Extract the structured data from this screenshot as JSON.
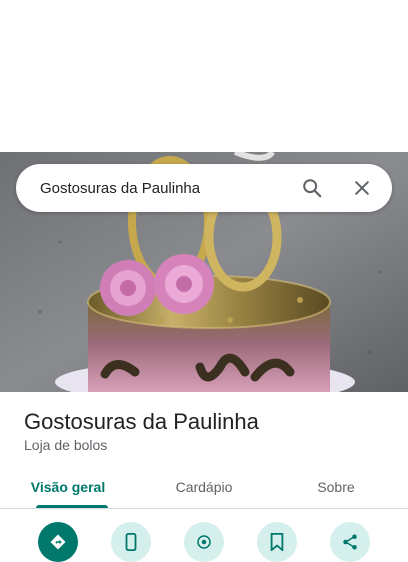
{
  "search": {
    "query": "Gostosuras da Paulinha"
  },
  "place": {
    "name": "Gostosuras da Paulinha",
    "category": "Loja de bolos"
  },
  "tabs": [
    {
      "label": "Visão geral",
      "active": true
    },
    {
      "label": "Cardápio",
      "active": false
    },
    {
      "label": "Sobre",
      "active": false
    }
  ],
  "actions": [
    "directions-icon",
    "phone-icon",
    "nearby-icon",
    "save-icon",
    "share-icon"
  ],
  "colors": {
    "accent": "#00786c",
    "action_bg": "#d4efec"
  }
}
